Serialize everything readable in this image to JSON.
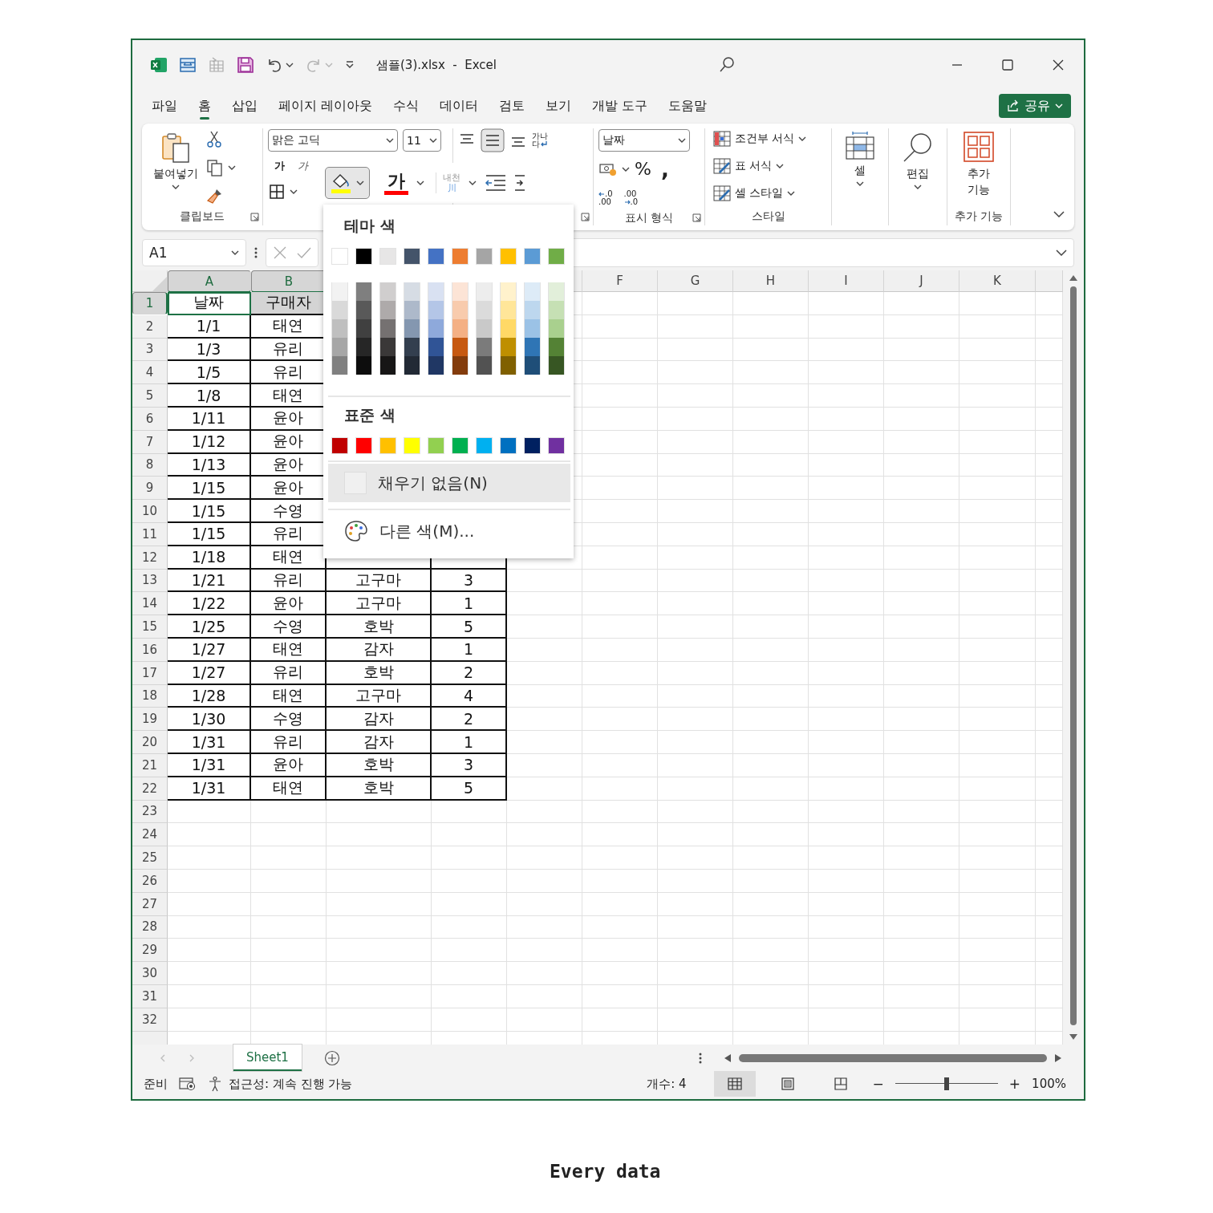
{
  "title_bar": {
    "title": "샘플(3).xlsx  -  Excel",
    "redo": {
      "disabled": true
    }
  },
  "menu_tabs": [
    {
      "label": "파일",
      "selected": false
    },
    {
      "label": "홈",
      "selected": true
    },
    {
      "label": "삽입",
      "selected": false
    },
    {
      "label": "페이지 레이아웃",
      "selected": false
    },
    {
      "label": "수식",
      "selected": false
    },
    {
      "label": "데이터",
      "selected": false
    },
    {
      "label": "검토",
      "selected": false
    },
    {
      "label": "보기",
      "selected": false
    },
    {
      "label": "개발 도구",
      "selected": false
    },
    {
      "label": "도움말",
      "selected": false
    }
  ],
  "share_button": {
    "label": "공유"
  },
  "ribbon": {
    "clipboard": {
      "paste": "붙여넣기",
      "label": "클립보드"
    },
    "font": {
      "name": "맑은 고딕",
      "size": "11",
      "bold": "가",
      "italic": "가",
      "font_color": "가",
      "fill_pressed": true,
      "phonetic": {
        "lines": [
          "내천",
          "川"
        ],
        "disabled": true
      }
    },
    "alignment": {
      "wrap_text": [
        "가나",
        "다"
      ]
    },
    "number": {
      "format": "날짜",
      "percent": "%",
      "comma": ",",
      "decimals": [
        {
          "top": ".0",
          "bottom": ".00"
        },
        {
          "top": ".00",
          "bottom": ".0"
        }
      ],
      "label": "표시 형식"
    },
    "styles": {
      "items": [
        "조건부 서식",
        "표 서식",
        "셀 스타일"
      ],
      "label": "스타일"
    },
    "cells": {
      "label": "셀"
    },
    "editing": {
      "label": "편집"
    },
    "addins": {
      "button": [
        "추가",
        "기능"
      ],
      "label": "추가 기능"
    }
  },
  "formula_bar": {
    "name_box": "A1"
  },
  "color_picker": {
    "theme_heading": "테마 색",
    "theme_colors": [
      {
        "color": "#ffffff",
        "shades": [
          {
            "color": "#f2f2f2"
          },
          {
            "color": "#d9d9d9"
          },
          {
            "color": "#bfbfbf"
          },
          {
            "color": "#a6a6a6"
          },
          {
            "color": "#808080"
          }
        ]
      },
      {
        "color": "#000000",
        "shades": [
          {
            "color": "#7f7f7f"
          },
          {
            "color": "#595959"
          },
          {
            "color": "#404040"
          },
          {
            "color": "#262626"
          },
          {
            "color": "#0d0d0d"
          }
        ]
      },
      {
        "color": "#e7e6e6",
        "shades": [
          {
            "color": "#d0cece"
          },
          {
            "color": "#aeaaaa"
          },
          {
            "color": "#757171"
          },
          {
            "color": "#3a3838"
          },
          {
            "color": "#171616"
          }
        ]
      },
      {
        "color": "#44546a",
        "shades": [
          {
            "color": "#d6dce4"
          },
          {
            "color": "#adb9ca"
          },
          {
            "color": "#8497b0"
          },
          {
            "color": "#333f4f"
          },
          {
            "color": "#222a35"
          }
        ]
      },
      {
        "color": "#4472c4",
        "shades": [
          {
            "color": "#d9e1f2"
          },
          {
            "color": "#b4c6e7"
          },
          {
            "color": "#8ea9db"
          },
          {
            "color": "#305496"
          },
          {
            "color": "#203764"
          }
        ]
      },
      {
        "color": "#ed7d31",
        "shades": [
          {
            "color": "#fce4d6"
          },
          {
            "color": "#f8cbad"
          },
          {
            "color": "#f4b084"
          },
          {
            "color": "#c65911"
          },
          {
            "color": "#833c0c"
          }
        ]
      },
      {
        "color": "#a5a5a5",
        "shades": [
          {
            "color": "#ededed"
          },
          {
            "color": "#dbdbdb"
          },
          {
            "color": "#c9c9c9"
          },
          {
            "color": "#7b7b7b"
          },
          {
            "color": "#525252"
          }
        ]
      },
      {
        "color": "#ffc000",
        "shades": [
          {
            "color": "#fff2cc"
          },
          {
            "color": "#ffe699"
          },
          {
            "color": "#ffd966"
          },
          {
            "color": "#bf8f00"
          },
          {
            "color": "#806000"
          }
        ]
      },
      {
        "color": "#5b9bd5",
        "shades": [
          {
            "color": "#ddebf7"
          },
          {
            "color": "#bdd7ee"
          },
          {
            "color": "#9bc2e6"
          },
          {
            "color": "#2f75b5"
          },
          {
            "color": "#1f4e78"
          }
        ]
      },
      {
        "color": "#70ad47",
        "shades": [
          {
            "color": "#e2efda"
          },
          {
            "color": "#c6e0b4"
          },
          {
            "color": "#a9d08e"
          },
          {
            "color": "#548235"
          },
          {
            "color": "#375623"
          }
        ]
      }
    ],
    "standard_heading": "표준 색",
    "standard_colors": [
      {
        "color": "#c00000"
      },
      {
        "color": "#ff0000"
      },
      {
        "color": "#ffc000"
      },
      {
        "color": "#ffff00"
      },
      {
        "color": "#92d050"
      },
      {
        "color": "#00b050"
      },
      {
        "color": "#00b0f0"
      },
      {
        "color": "#0070c0"
      },
      {
        "color": "#002060"
      },
      {
        "color": "#7030a0"
      }
    ],
    "no_fill": {
      "label": "채우기 없음(N)",
      "selected": true
    },
    "more_colors": "다른 색(M)..."
  },
  "grid": {
    "columns": [
      {
        "label": "A",
        "selected": true
      },
      {
        "label": "B",
        "selected": true
      },
      {
        "selected": false
      },
      {
        "label": "F",
        "selected": false
      },
      {
        "label": "G",
        "selected": false
      },
      {
        "label": "H",
        "selected": false
      },
      {
        "label": "I",
        "selected": false
      },
      {
        "label": "J",
        "selected": false
      },
      {
        "label": "K",
        "selected": false
      }
    ],
    "rows": [
      {
        "header": "1",
        "selected": true,
        "cells": [
          "날짜",
          "구매자"
        ]
      },
      {
        "header": "2",
        "selected": false,
        "cells": [
          "1/1",
          "태연"
        ]
      },
      {
        "header": "3",
        "selected": false,
        "cells": [
          "1/3",
          "유리"
        ]
      },
      {
        "header": "4",
        "selected": false,
        "cells": [
          "1/5",
          "유리"
        ]
      },
      {
        "header": "5",
        "selected": false,
        "cells": [
          "1/8",
          "태연"
        ]
      },
      {
        "header": "6",
        "selected": false,
        "cells": [
          "1/11",
          "윤아"
        ]
      },
      {
        "header": "7",
        "selected": false,
        "cells": [
          "1/12",
          "윤아"
        ]
      },
      {
        "header": "8",
        "selected": false,
        "cells": [
          "1/13",
          "윤아"
        ]
      },
      {
        "header": "9",
        "selected": false,
        "cells": [
          "1/15",
          "윤아"
        ]
      },
      {
        "header": "10",
        "selected": false,
        "cells": [
          "1/15",
          "수영"
        ]
      },
      {
        "header": "11",
        "selected": false,
        "cells": [
          "1/15",
          "유리"
        ]
      },
      {
        "header": "12",
        "selected": false,
        "cells": [
          "1/18",
          "태연"
        ]
      },
      {
        "header": "13",
        "selected": false,
        "cells": [
          "1/21",
          "유리",
          "고구마",
          "3"
        ]
      },
      {
        "header": "14",
        "selected": false,
        "cells": [
          "1/22",
          "윤아",
          "고구마",
          "1"
        ]
      },
      {
        "header": "15",
        "selected": false,
        "cells": [
          "1/25",
          "수영",
          "호박",
          "5"
        ]
      },
      {
        "header": "16",
        "selected": false,
        "cells": [
          "1/27",
          "태연",
          "감자",
          "1"
        ]
      },
      {
        "header": "17",
        "selected": false,
        "cells": [
          "1/27",
          "유리",
          "호박",
          "2"
        ]
      },
      {
        "header": "18",
        "selected": false,
        "cells": [
          "1/28",
          "태연",
          "고구마",
          "4"
        ]
      },
      {
        "header": "19",
        "selected": false,
        "cells": [
          "1/30",
          "수영",
          "감자",
          "2"
        ]
      },
      {
        "header": "20",
        "selected": false,
        "cells": [
          "1/31",
          "유리",
          "감자",
          "1"
        ]
      },
      {
        "header": "21",
        "selected": false,
        "cells": [
          "1/31",
          "윤아",
          "호박",
          "3"
        ]
      },
      {
        "header": "22",
        "selected": false,
        "cells": [
          "1/31",
          "태연",
          "호박",
          "5"
        ]
      },
      {
        "header": "23",
        "selected": false
      },
      {
        "header": "24",
        "selected": false
      },
      {
        "header": "25",
        "selected": false
      },
      {
        "header": "26",
        "selected": false
      },
      {
        "header": "27",
        "selected": false
      },
      {
        "header": "28",
        "selected": false
      },
      {
        "header": "29",
        "selected": false
      },
      {
        "header": "30",
        "selected": false
      },
      {
        "header": "31",
        "selected": false
      },
      {
        "header": "32",
        "selected": false
      }
    ]
  },
  "sheet_tabs": [
    {
      "label": "Sheet1",
      "selected": true
    }
  ],
  "status_bar": {
    "ready": "준비",
    "accessibility": "접근성: 계속 진행 가능",
    "count": "개수: 4",
    "views": [
      {
        "kind": "normal",
        "selected": true
      },
      {
        "kind": "page_layout",
        "selected": false
      },
      {
        "kind": "page_break",
        "selected": false
      }
    ],
    "zoom_minus": "−",
    "zoom_plus": "+",
    "zoom": {
      "level": 0.5
    },
    "zoom_text": "100%"
  },
  "caption": "Every data"
}
